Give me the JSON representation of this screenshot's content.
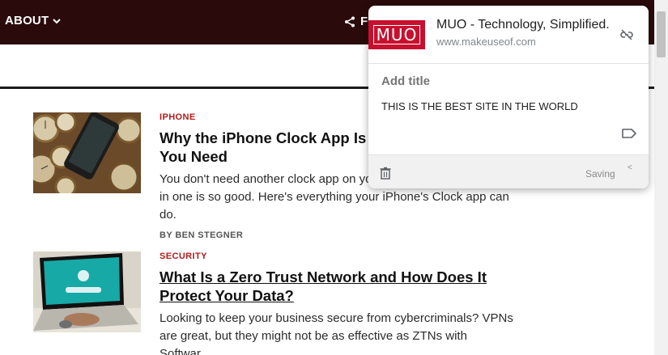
{
  "nav": {
    "about_label": "ABOUT",
    "share_label": "FO"
  },
  "articles": [
    {
      "category": "IPHONE",
      "title": "Why the iPhone Clock App Is the Only Clock App You Need",
      "excerpt": "You don't need another clock app on your iPhone when the built-in one is so good. Here's everything your iPhone's Clock app can do.",
      "byline": "BY BEN STEGNER"
    },
    {
      "category": "SECURITY",
      "title": "What Is a Zero Trust Network and How Does It Protect Your Data?",
      "excerpt": "Looking to keep your business secure from cybercriminals? VPNs are great, but they might not be as effective as ZTNs with Softwar…"
    }
  ],
  "bookmark": {
    "favicon_text": "MUO",
    "site_title": "MUO - Technology, Simplified.",
    "site_url": "www.makeuseof.com",
    "title_placeholder": "Add title",
    "note": "THIS IS THE BEST SITE IN THE WORLD",
    "status": "Saving"
  },
  "colors": {
    "nav_bg": "#2a0a0a",
    "category": "#b01c1c",
    "favicon_bg": "#c8102e"
  }
}
